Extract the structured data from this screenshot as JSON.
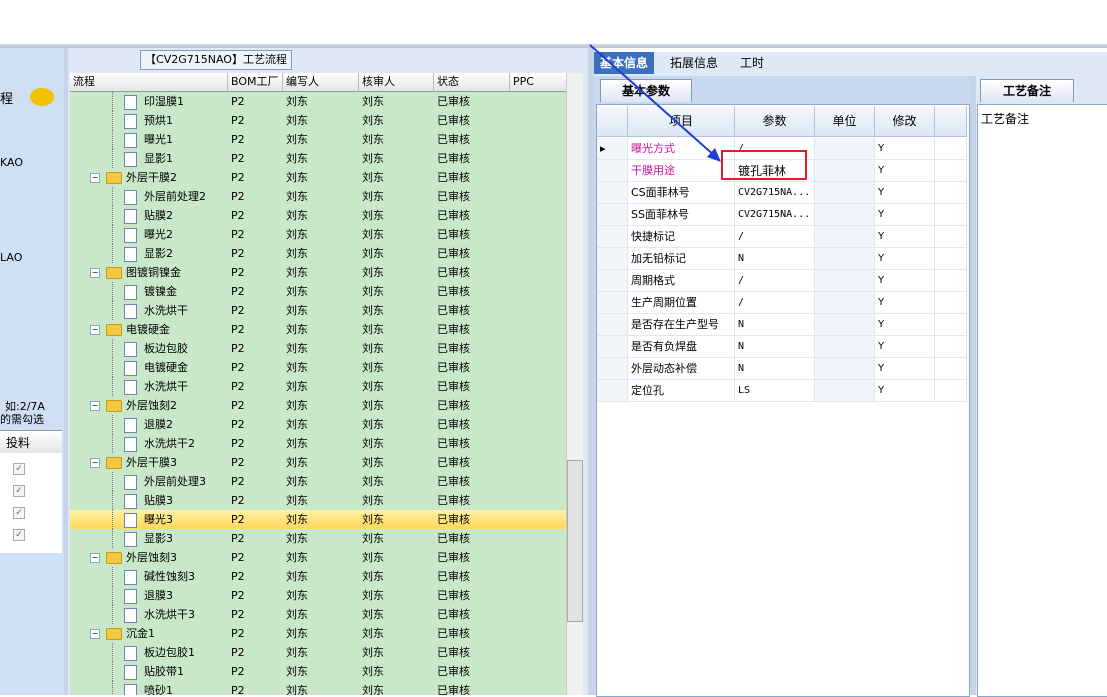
{
  "left_panel": {
    "label_top": "程",
    "label_kao": "KAO",
    "label_lao": "LAO",
    "note_line1": "如:2/7A",
    "note_line2": "的需勾选",
    "column_label": "投料"
  },
  "process": {
    "title": "【CV2G715NAO】工艺流程",
    "headers": [
      "流程",
      "BOM工厂",
      "编写人",
      "核审人",
      "状态",
      "PPC"
    ],
    "rows": [
      {
        "name": "印湿膜1",
        "level": 2,
        "bom": "P2",
        "writer": "刘东",
        "reviewer": "刘东",
        "status": "已审核"
      },
      {
        "name": "预烘1",
        "level": 2,
        "bom": "P2",
        "writer": "刘东",
        "reviewer": "刘东",
        "status": "已审核"
      },
      {
        "name": "曝光1",
        "level": 2,
        "bom": "P2",
        "writer": "刘东",
        "reviewer": "刘东",
        "status": "已审核"
      },
      {
        "name": "显影1",
        "level": 2,
        "bom": "P2",
        "writer": "刘东",
        "reviewer": "刘东",
        "status": "已审核"
      },
      {
        "name": "外层干膜2",
        "level": 1,
        "bom": "P2",
        "writer": "刘东",
        "reviewer": "刘东",
        "status": "已审核"
      },
      {
        "name": "外层前处理2",
        "level": 2,
        "bom": "P2",
        "writer": "刘东",
        "reviewer": "刘东",
        "status": "已审核"
      },
      {
        "name": "贴膜2",
        "level": 2,
        "bom": "P2",
        "writer": "刘东",
        "reviewer": "刘东",
        "status": "已审核"
      },
      {
        "name": "曝光2",
        "level": 2,
        "bom": "P2",
        "writer": "刘东",
        "reviewer": "刘东",
        "status": "已审核"
      },
      {
        "name": "显影2",
        "level": 2,
        "bom": "P2",
        "writer": "刘东",
        "reviewer": "刘东",
        "status": "已审核"
      },
      {
        "name": "图镀铜镍金",
        "level": 1,
        "bom": "P2",
        "writer": "刘东",
        "reviewer": "刘东",
        "status": "已审核"
      },
      {
        "name": "镀镍金",
        "level": 2,
        "bom": "P2",
        "writer": "刘东",
        "reviewer": "刘东",
        "status": "已审核"
      },
      {
        "name": "水洗烘干",
        "level": 2,
        "bom": "P2",
        "writer": "刘东",
        "reviewer": "刘东",
        "status": "已审核"
      },
      {
        "name": "电镀硬金",
        "level": 1,
        "bom": "P2",
        "writer": "刘东",
        "reviewer": "刘东",
        "status": "已审核"
      },
      {
        "name": "板边包胶",
        "level": 2,
        "bom": "P2",
        "writer": "刘东",
        "reviewer": "刘东",
        "status": "已审核"
      },
      {
        "name": "电镀硬金",
        "level": 2,
        "bom": "P2",
        "writer": "刘东",
        "reviewer": "刘东",
        "status": "已审核"
      },
      {
        "name": "水洗烘干",
        "level": 2,
        "bom": "P2",
        "writer": "刘东",
        "reviewer": "刘东",
        "status": "已审核"
      },
      {
        "name": "外层蚀刻2",
        "level": 1,
        "bom": "P2",
        "writer": "刘东",
        "reviewer": "刘东",
        "status": "已审核"
      },
      {
        "name": "退膜2",
        "level": 2,
        "bom": "P2",
        "writer": "刘东",
        "reviewer": "刘东",
        "status": "已审核"
      },
      {
        "name": "水洗烘干2",
        "level": 2,
        "bom": "P2",
        "writer": "刘东",
        "reviewer": "刘东",
        "status": "已审核"
      },
      {
        "name": "外层干膜3",
        "level": 1,
        "bom": "P2",
        "writer": "刘东",
        "reviewer": "刘东",
        "status": "已审核"
      },
      {
        "name": "外层前处理3",
        "level": 2,
        "bom": "P2",
        "writer": "刘东",
        "reviewer": "刘东",
        "status": "已审核"
      },
      {
        "name": "贴膜3",
        "level": 2,
        "bom": "P2",
        "writer": "刘东",
        "reviewer": "刘东",
        "status": "已审核"
      },
      {
        "name": "曝光3",
        "level": 2,
        "bom": "P2",
        "writer": "刘东",
        "reviewer": "刘东",
        "status": "已审核",
        "selected": true
      },
      {
        "name": "显影3",
        "level": 2,
        "bom": "P2",
        "writer": "刘东",
        "reviewer": "刘东",
        "status": "已审核"
      },
      {
        "name": "外层蚀刻3",
        "level": 1,
        "bom": "P2",
        "writer": "刘东",
        "reviewer": "刘东",
        "status": "已审核"
      },
      {
        "name": "碱性蚀刻3",
        "level": 2,
        "bom": "P2",
        "writer": "刘东",
        "reviewer": "刘东",
        "status": "已审核"
      },
      {
        "name": "退膜3",
        "level": 2,
        "bom": "P2",
        "writer": "刘东",
        "reviewer": "刘东",
        "status": "已审核"
      },
      {
        "name": "水洗烘干3",
        "level": 2,
        "bom": "P2",
        "writer": "刘东",
        "reviewer": "刘东",
        "status": "已审核"
      },
      {
        "name": "沉金1",
        "level": 1,
        "bom": "P2",
        "writer": "刘东",
        "reviewer": "刘东",
        "status": "已审核"
      },
      {
        "name": "板边包胶1",
        "level": 2,
        "bom": "P2",
        "writer": "刘东",
        "reviewer": "刘东",
        "status": "已审核"
      },
      {
        "name": "贴胶带1",
        "level": 2,
        "bom": "P2",
        "writer": "刘东",
        "reviewer": "刘东",
        "status": "已审核"
      },
      {
        "name": "喷砂1",
        "level": 2,
        "bom": "P2",
        "writer": "刘东",
        "reviewer": "刘东",
        "status": "已审核"
      }
    ]
  },
  "right_tabs": [
    "基本信息",
    "拓展信息",
    "工时"
  ],
  "basic_params": {
    "subtab": "基本参数",
    "headers": [
      "项目",
      "参数",
      "单位",
      "修改"
    ],
    "rows": [
      {
        "item": "曝光方式",
        "param": "/",
        "unit": "",
        "modify": "Y",
        "highlight": "magenta"
      },
      {
        "item": "干膜用途",
        "param": "镀孔菲林",
        "unit": "",
        "modify": "Y",
        "highlight": "magenta"
      },
      {
        "item": "CS面菲林号",
        "param": "CV2G715NA...",
        "unit": "",
        "modify": "Y"
      },
      {
        "item": "SS面菲林号",
        "param": "CV2G715NA...",
        "unit": "",
        "modify": "Y"
      },
      {
        "item": "快捷标记",
        "param": "/",
        "unit": "",
        "modify": "Y"
      },
      {
        "item": "加无铅标记",
        "param": "N",
        "unit": "",
        "modify": "Y"
      },
      {
        "item": "周期格式",
        "param": "/",
        "unit": "",
        "modify": "Y"
      },
      {
        "item": "生产周期位置",
        "param": "/",
        "unit": "",
        "modify": "Y"
      },
      {
        "item": "是否存在生产型号",
        "param": "N",
        "unit": "",
        "modify": "Y"
      },
      {
        "item": "是否有负焊盘",
        "param": "N",
        "unit": "",
        "modify": "Y"
      },
      {
        "item": "外层动态补偿",
        "param": "N",
        "unit": "",
        "modify": "Y"
      },
      {
        "item": "定位孔",
        "param": "LS",
        "unit": "",
        "modify": "Y"
      }
    ]
  },
  "remark": {
    "tab": "工艺备注",
    "label": "工艺备注"
  },
  "colors": {
    "accent": "#3c6fbd",
    "row_green": "#c9e8c9",
    "selected_row": "#ffd75a",
    "highlight_text": "#c0189a",
    "annotation_red": "#e02020",
    "annotation_arrow": "#1f3ed6"
  }
}
